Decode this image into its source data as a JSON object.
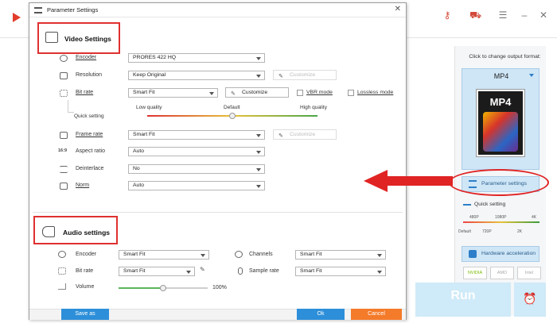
{
  "dialog": {
    "title": "Parameter Settings",
    "close_glyph": "✕"
  },
  "video": {
    "section_title": "Video Settings",
    "encoder": {
      "label": "Encoder",
      "value": "PRORES 422 HQ"
    },
    "resolution": {
      "label": "Resolution",
      "value": "Keep Original",
      "customize": "Customize"
    },
    "bitrate": {
      "label": "Bit rate",
      "value": "Smart Fit",
      "customize": "Customize",
      "vbr": "VBR mode",
      "lossless": "Lossless mode"
    },
    "quick": {
      "label": "Quick setting",
      "low": "Low quality",
      "default": "Default",
      "high": "High quality",
      "level": 0.5
    },
    "framerate": {
      "label": "Frame rate",
      "value": "Smart Fit",
      "customize": "Customize"
    },
    "aspect": {
      "label": "Aspect ratio",
      "value": "Auto",
      "icon_text": "16:9"
    },
    "deinterlace": {
      "label": "Deinterlace",
      "value": "No"
    },
    "norm": {
      "label": "Norm",
      "value": "Auto"
    }
  },
  "audio": {
    "section_title": "Audio settings",
    "encoder": {
      "label": "Encoder",
      "value": "Smart Fit"
    },
    "channels": {
      "label": "Channels",
      "value": "Smart Fit"
    },
    "bitrate": {
      "label": "Bit rate",
      "value": "Smart Fit"
    },
    "samplerate": {
      "label": "Sample rate",
      "value": "Smart Fit"
    },
    "volume": {
      "label": "Volume",
      "value": "100%",
      "level": 0.5
    }
  },
  "footer": {
    "save_as": "Save as",
    "ok": "Ok",
    "cancel": "Cancel"
  },
  "right_panel": {
    "title": "Click to change output format:",
    "format": "MP4",
    "format_box_label": "MP4",
    "param_btn": "Parameter settings",
    "quick_setting": "Quick setting",
    "ticks_top": [
      "480P",
      "1080P",
      "4K"
    ],
    "ticks_bottom": [
      "Default",
      "720P",
      "2K"
    ],
    "hw_acc": "Hardware acceleration",
    "gpus": [
      "NVIDIA",
      "AMD",
      "Intel"
    ],
    "run": "Run"
  },
  "colors": {
    "accent": "#2d8fd9",
    "cancel": "#f47b2a",
    "annotation": "#e02424"
  }
}
